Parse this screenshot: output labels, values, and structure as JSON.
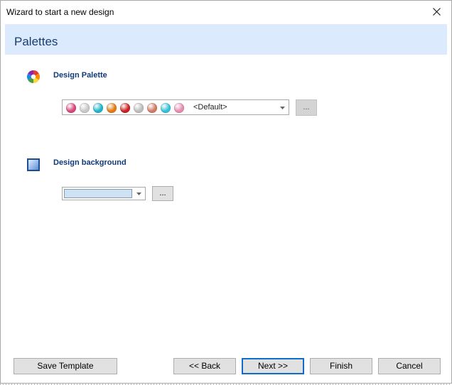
{
  "window": {
    "title": "Wizard to start a new design"
  },
  "banner": {
    "title": "Palettes"
  },
  "palette_section": {
    "label": "Design Palette",
    "selected_value": "<Default>",
    "browse_label": "...",
    "swatch_colors": [
      "#d9447a",
      "#c8c8c8",
      "#1fb5c9",
      "#e07a0d",
      "#cc1f1f",
      "#bdbdbd",
      "#cf7a62",
      "#31c1d8",
      "#e88ab0"
    ]
  },
  "background_section": {
    "label": "Design background",
    "selected_color": "#cfe2f3",
    "browse_label": "..."
  },
  "footer": {
    "save_template": "Save Template",
    "back": "<< Back",
    "next": "Next >>",
    "finish": "Finish",
    "cancel": "Cancel"
  },
  "colors": {
    "banner_bg": "#dbeafc",
    "banner_text": "#1a3e6e",
    "section_label": "#0f3a78",
    "default_button_border": "#0f6dcc"
  },
  "icons": {
    "palette_section": "color-wheel-icon",
    "background_section": "background-square-icon",
    "close": "close-icon",
    "dropdown": "chevron-down-icon"
  }
}
